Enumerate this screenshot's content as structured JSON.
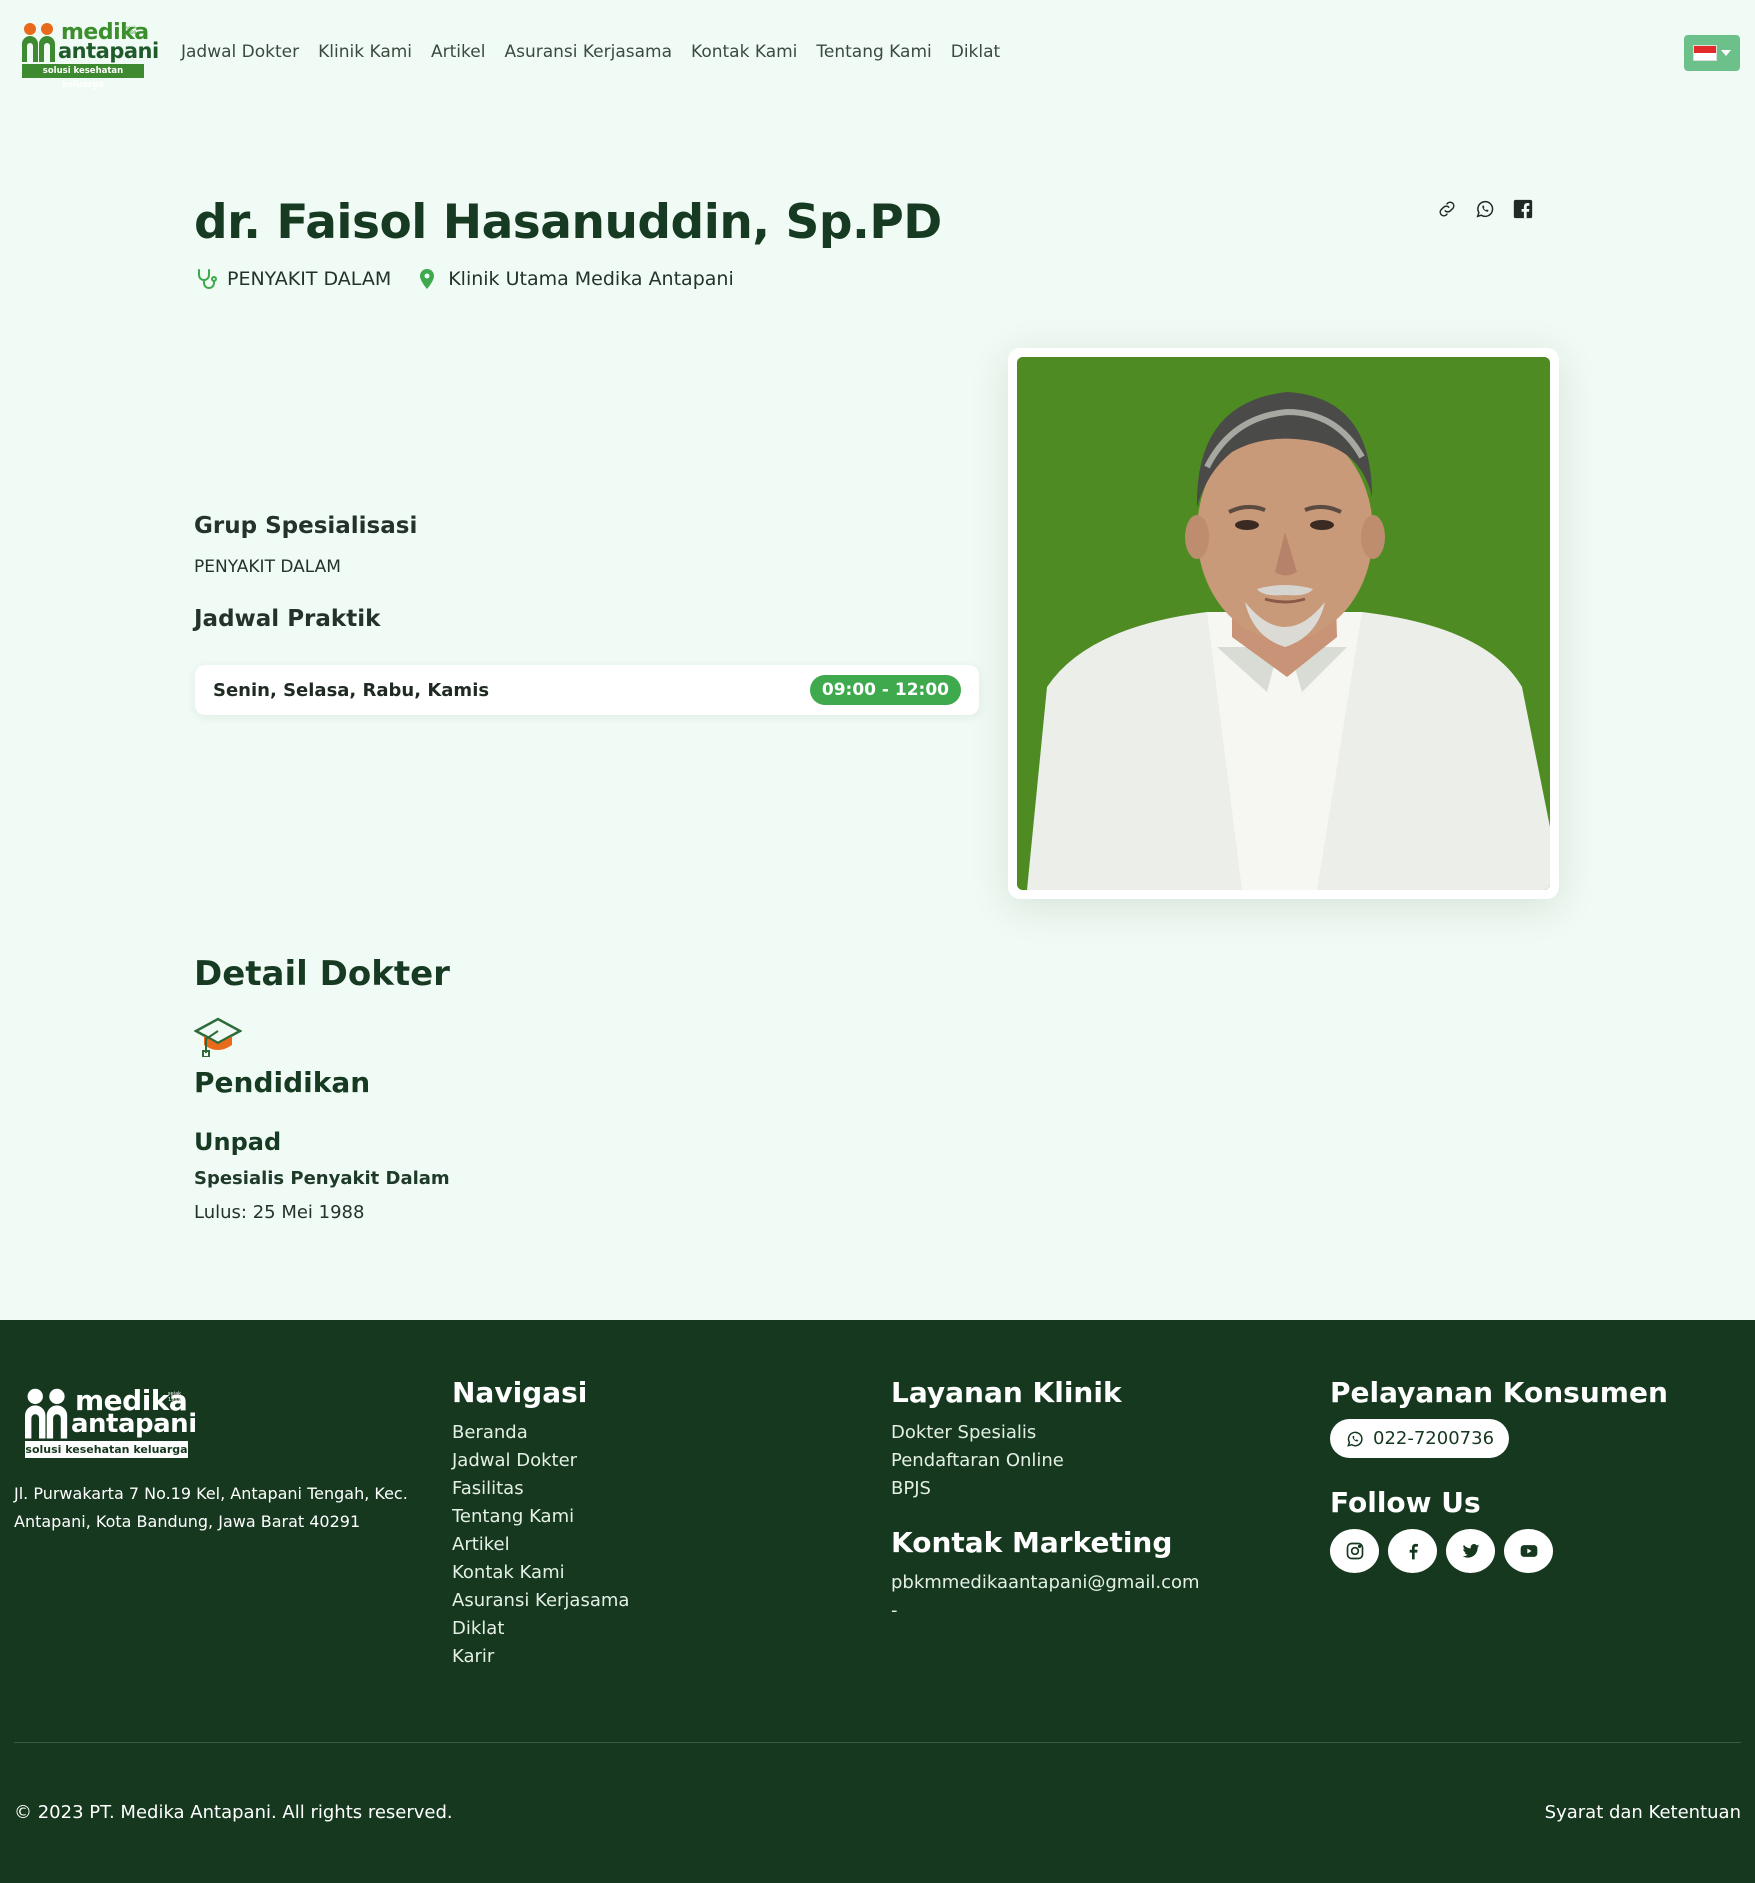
{
  "brand": {
    "name_top": "medika",
    "name_bottom": "antapani",
    "tagline": "solusi kesehatan keluarga",
    "since": "sejak 1989"
  },
  "nav": {
    "items": [
      "Jadwal Dokter",
      "Klinik Kami",
      "Artikel",
      "Asuransi Kerjasama",
      "Kontak Kami",
      "Tentang Kami",
      "Diklat"
    ]
  },
  "language": {
    "flag": "indonesia-flag",
    "colors": {
      "top": "#e12b2b",
      "bottom": "#ffffff"
    }
  },
  "doctor": {
    "name": "dr. Faisol Hasanuddin, Sp.PD",
    "specialty": "PENYAKIT DALAM",
    "clinic": "Klinik Utama Medika Antapani",
    "share_icons": [
      "link-icon",
      "whatsapp-icon",
      "facebook-icon"
    ]
  },
  "specialization": {
    "heading": "Grup Spesialisasi",
    "value": "PENYAKIT DALAM"
  },
  "schedule": {
    "heading": "Jadwal Praktik",
    "rows": [
      {
        "days": "Senin, Selasa, Rabu, Kamis",
        "time": "09:00 - 12:00"
      }
    ]
  },
  "detail": {
    "heading": "Detail Dokter",
    "education": {
      "heading": "Pendidikan",
      "university": "Unpad",
      "program": "Spesialis Penyakit Dalam",
      "graduated": "Lulus: 25 Mei 1988"
    }
  },
  "footer": {
    "address": "Jl. Purwakarta 7 No.19 Kel, Antapani Tengah, Kec. Antapani, Kota Bandung, Jawa Barat 40291",
    "navigasi": {
      "heading": "Navigasi",
      "links": [
        "Beranda",
        "Jadwal Dokter",
        "Fasilitas",
        "Tentang Kami",
        "Artikel",
        "Kontak Kami",
        "Asuransi Kerjasama",
        "Diklat",
        "Karir"
      ]
    },
    "layanan": {
      "heading": "Layanan Klinik",
      "links": [
        "Dokter Spesialis",
        "Pendaftaran Online",
        "BPJS"
      ]
    },
    "marketing": {
      "heading": "Kontak Marketing",
      "email": "pbkmmedikaantapani@gmail.com",
      "extra": "-"
    },
    "konsumen": {
      "heading": "Pelayanan Konsumen",
      "phone": "022-7200736"
    },
    "follow": {
      "heading": "Follow Us",
      "icons": [
        "instagram-icon",
        "facebook-icon",
        "twitter-icon",
        "youtube-icon"
      ]
    },
    "copyright": "© 2023 PT. Medika Antapani. All rights reserved.",
    "terms": "Syarat dan Ketentuan"
  },
  "colors": {
    "background": "#f1fbf5",
    "footer": "#16381f",
    "accent": "#3fa94e",
    "photo_bg": "#4e8b22"
  }
}
